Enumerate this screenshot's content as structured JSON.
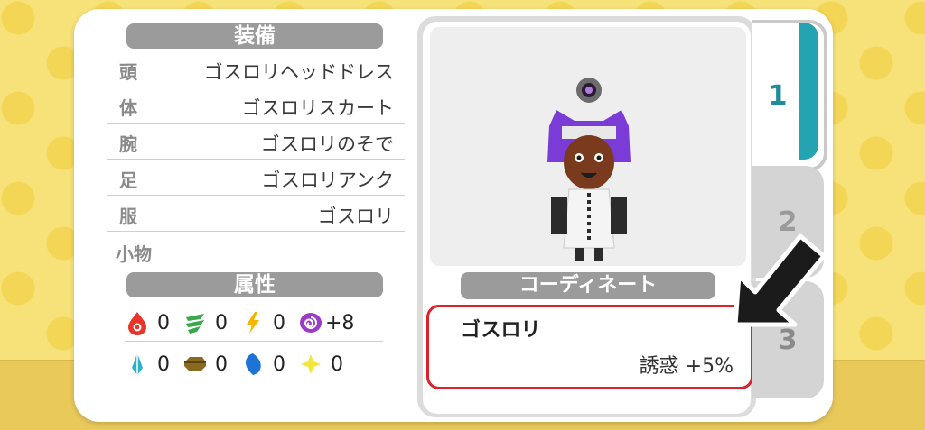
{
  "equipment": {
    "header": "装備",
    "slots": [
      {
        "slot": "頭",
        "item": "ゴスロリヘッドドレス"
      },
      {
        "slot": "体",
        "item": "ゴスロリスカート"
      },
      {
        "slot": "腕",
        "item": "ゴスロリのそで"
      },
      {
        "slot": "足",
        "item": "ゴスロリアンク"
      },
      {
        "slot": "服",
        "item": "ゴスロリ"
      }
    ],
    "accessory_label": "小物"
  },
  "attributes": {
    "header": "属性",
    "row1": [
      {
        "icon": "fire-icon",
        "value": "0"
      },
      {
        "icon": "wind-icon",
        "value": "0"
      },
      {
        "icon": "lightning-icon",
        "value": "0"
      },
      {
        "icon": "charm-icon",
        "value": "+8"
      }
    ],
    "row2": [
      {
        "icon": "ice-icon",
        "value": "0"
      },
      {
        "icon": "earth-icon",
        "value": "0"
      },
      {
        "icon": "water-icon",
        "value": "0"
      },
      {
        "icon": "light-icon",
        "value": "0"
      }
    ]
  },
  "coordinate": {
    "header": "コーディネート",
    "name": "ゴスロリ",
    "effect": "誘惑 +5%"
  },
  "tabs": [
    {
      "label": "1",
      "active": true
    },
    {
      "label": "2",
      "active": false
    },
    {
      "label": "3",
      "active": false
    }
  ],
  "colors": {
    "accent": "#24a3b3",
    "highlight": "#e0202a",
    "header_gray": "#9b9b9b"
  }
}
